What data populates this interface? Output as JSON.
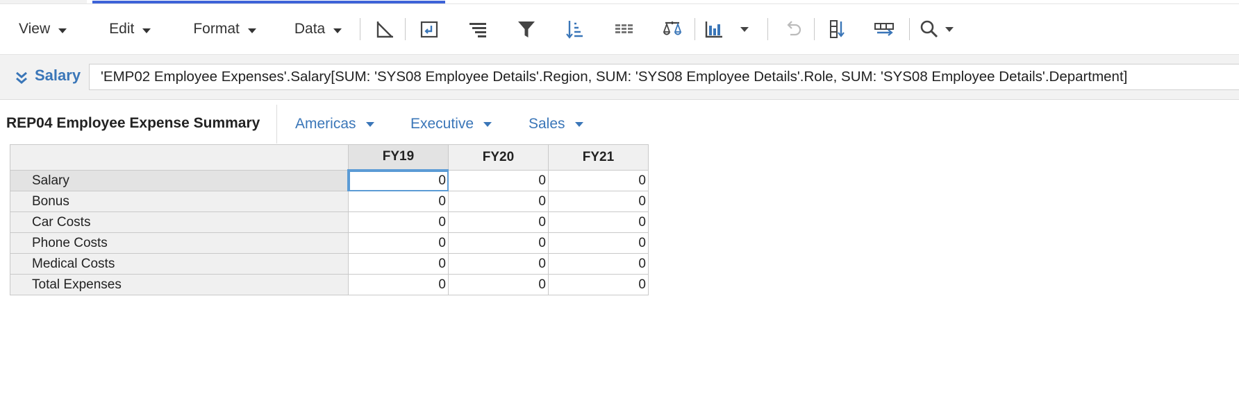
{
  "menus": [
    {
      "label": "View"
    },
    {
      "label": "Edit"
    },
    {
      "label": "Format"
    },
    {
      "label": "Data"
    }
  ],
  "toolbar_icons": [
    "axis-icon",
    "pivot-icon",
    "align-icon",
    "filter-icon",
    "sort-icon",
    "grid-icon",
    "balance-icon",
    "chart-icon",
    "undo-icon",
    "insert-column-icon",
    "insert-row-icon",
    "search-icon"
  ],
  "formula": {
    "label": "Salary",
    "value": "'EMP02 Employee Expenses'.Salary[SUM: 'SYS08 Employee Details'.Region, SUM: 'SYS08 Employee Details'.Role, SUM: 'SYS08 Employee Details'.Department]"
  },
  "report": {
    "title": "REP04 Employee Expense Summary",
    "filters": [
      {
        "label": "Americas"
      },
      {
        "label": "Executive"
      },
      {
        "label": "Sales"
      }
    ]
  },
  "grid": {
    "columns": [
      "FY19",
      "FY20",
      "FY21"
    ],
    "rows": [
      {
        "label": "Salary",
        "values": [
          "0",
          "0",
          "0"
        ]
      },
      {
        "label": "Bonus",
        "values": [
          "0",
          "0",
          "0"
        ]
      },
      {
        "label": "Car Costs",
        "values": [
          "0",
          "0",
          "0"
        ]
      },
      {
        "label": "Phone Costs",
        "values": [
          "0",
          "0",
          "0"
        ]
      },
      {
        "label": "Medical Costs",
        "values": [
          "0",
          "0",
          "0"
        ]
      },
      {
        "label": "Total Expenses",
        "values": [
          "0",
          "0",
          "0"
        ]
      }
    ]
  },
  "colors": {
    "accent": "#3a76b8",
    "selection": "#5b9bd5",
    "progress": "#3d63d8"
  }
}
